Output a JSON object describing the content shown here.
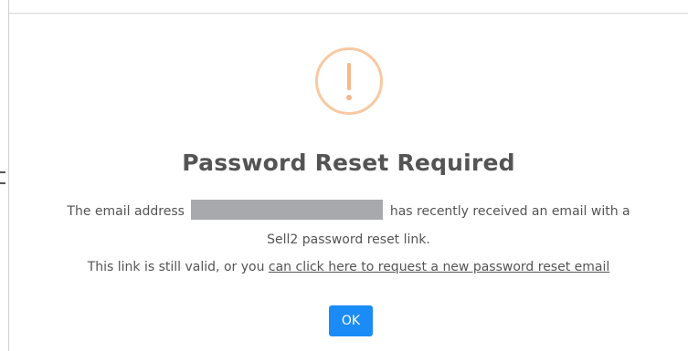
{
  "dialog": {
    "icon": "exclamation-warning-icon",
    "title": "Password Reset Required",
    "line1_prefix": "The email address",
    "line1_suffix": "has recently received an email with a",
    "line2": "Sell2 password reset link.",
    "line3_prefix": "This link is still valid, or you",
    "reset_link": "can click here to request a new password reset email",
    "ok_label": "OK"
  },
  "colors": {
    "icon_ring": "#f8c9a2",
    "icon_mark": "#f5b889",
    "text": "#545454",
    "button": "#1b8cf7",
    "redaction": "#a7a9ac"
  }
}
